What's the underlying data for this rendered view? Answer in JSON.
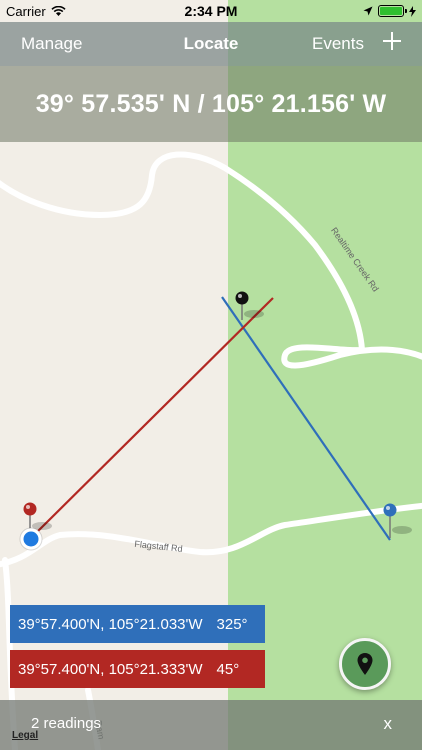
{
  "status": {
    "carrier": "Carrier",
    "time": "2:34 PM",
    "battery_level": 1.0
  },
  "nav": {
    "left": "Manage",
    "title": "Locate",
    "right": "Events",
    "add_icon": "plus-icon"
  },
  "header": {
    "coordinate": "39° 57.535' N / 105° 21.156' W"
  },
  "map": {
    "road_labels": [
      "Realtime Creek Rd",
      "Flagstaff Rd",
      "Dam"
    ],
    "colors": {
      "land": "#f2eee7",
      "park": "#b5e0a0",
      "road": "#ffffff",
      "blue_line": "#2f6fba",
      "red_line": "#b22823"
    }
  },
  "readings": [
    {
      "coord": "39°57.400'N, 105°21.033'W",
      "bearing": "325°",
      "color": "#2f6fba"
    },
    {
      "coord": "39°57.400'N, 105°21.333'W",
      "bearing": "45°",
      "color": "#b22823"
    }
  ],
  "locate_button": {
    "icon": "map-pin-icon"
  },
  "bottom": {
    "count": "2 readings",
    "close": "x",
    "legal": "Legal"
  }
}
